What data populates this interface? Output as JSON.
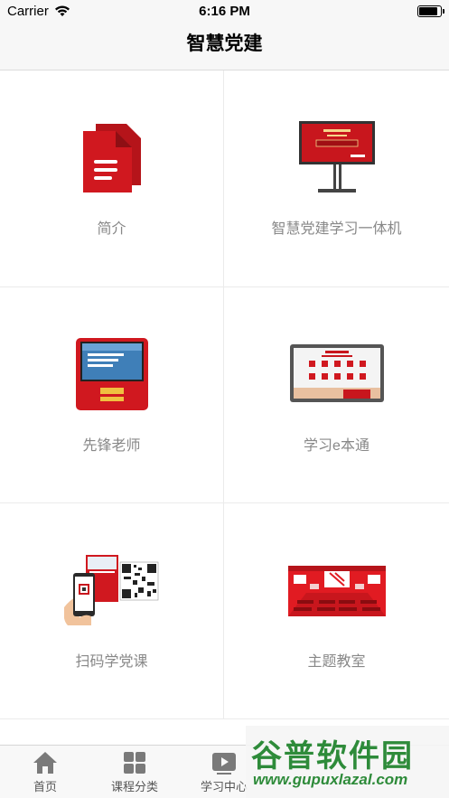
{
  "status_bar": {
    "carrier": "Carrier",
    "time": "6:16 PM",
    "battery_level": 0.9
  },
  "nav": {
    "title": "智慧党建"
  },
  "grid": {
    "items": [
      {
        "label": "简介",
        "icon": "document-icon"
      },
      {
        "label": "智慧党建学习一体机",
        "icon": "display-board-icon"
      },
      {
        "label": "先锋老师",
        "icon": "kiosk-terminal-icon"
      },
      {
        "label": "学习e本通",
        "icon": "tablet-icon"
      },
      {
        "label": "扫码学党课",
        "icon": "qr-scan-phone-icon"
      },
      {
        "label": "主题教室",
        "icon": "classroom-icon"
      }
    ]
  },
  "tab_bar": {
    "tabs": [
      {
        "label": "首页",
        "icon": "home-icon"
      },
      {
        "label": "课程分类",
        "icon": "grid-icon"
      },
      {
        "label": "学习中心",
        "icon": "play-icon"
      }
    ]
  },
  "watermark": {
    "title": "谷普软件园",
    "url": "www.gupuxlazal.com"
  },
  "colors": {
    "accent_red": "#c8161d",
    "label_gray": "#888888",
    "watermark_green": "#2e8b3a"
  }
}
